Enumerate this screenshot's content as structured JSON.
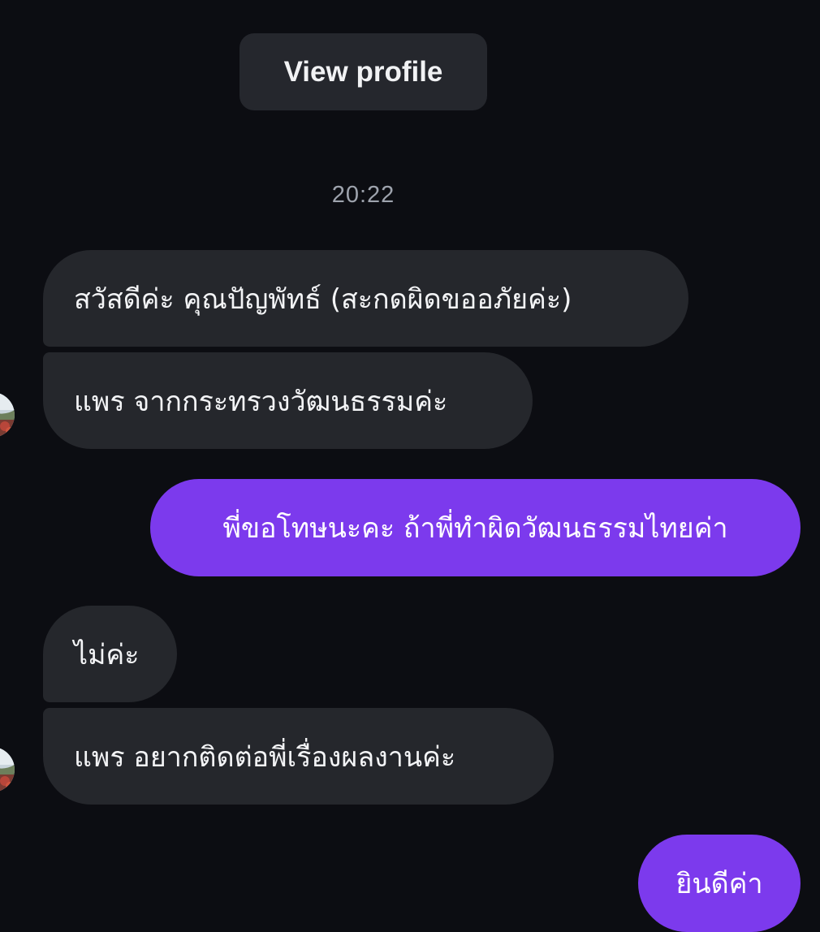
{
  "header": {
    "view_profile_label": "View profile"
  },
  "conversation": {
    "timestamp": "20:22",
    "messages": [
      {
        "direction": "incoming",
        "text": "สวัสดีค่ะ คุณปัญพัทธ์ (สะกดผิดขออภัยค่ะ)"
      },
      {
        "direction": "incoming",
        "text": "แพร จากกระทรวงวัฒนธรรมค่ะ"
      },
      {
        "direction": "outgoing",
        "text": "พี่ขอโทษนะคะ ถ้าพี่ทำผิดวัฒนธรรมไทยค่า"
      },
      {
        "direction": "incoming",
        "text": "ไม่ค่ะ"
      },
      {
        "direction": "incoming",
        "text": "แพร อยากติดต่อพี่เรื่องผลงานค่ะ"
      },
      {
        "direction": "outgoing",
        "text": "ยินดีค่า"
      }
    ]
  },
  "colors": {
    "background": "#0c0d12",
    "incoming_bubble": "#25272c",
    "outgoing_bubble": "#7c3aed",
    "timestamp_text": "#9ea3ad"
  },
  "icons": {
    "avatar": "contact-avatar"
  }
}
